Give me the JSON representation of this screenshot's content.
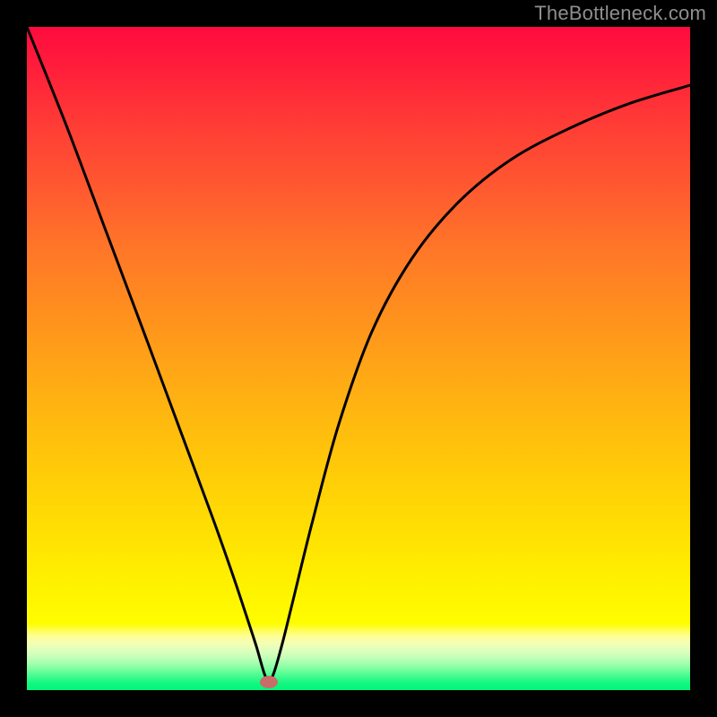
{
  "watermark": "TheBottleneck.com",
  "chart_data": {
    "type": "line",
    "title": "",
    "xlabel": "",
    "ylabel": "",
    "xlim": [
      0,
      1
    ],
    "ylim": [
      0,
      1
    ],
    "grid": false,
    "legend": false,
    "series": [
      {
        "name": "curve",
        "x": [
          0.0,
          0.06,
          0.12,
          0.18,
          0.23,
          0.28,
          0.31,
          0.33,
          0.346,
          0.36,
          0.37,
          0.384,
          0.4,
          0.43,
          0.47,
          0.52,
          0.58,
          0.65,
          0.73,
          0.82,
          0.91,
          1.0
        ],
        "y": [
          1.0,
          0.85,
          0.69,
          0.53,
          0.395,
          0.26,
          0.175,
          0.115,
          0.066,
          0.02,
          0.02,
          0.066,
          0.13,
          0.252,
          0.4,
          0.54,
          0.65,
          0.735,
          0.8,
          0.848,
          0.885,
          0.912
        ]
      }
    ],
    "marker": {
      "x": 0.365,
      "y": 0.012
    },
    "background": {
      "type": "vertical-gradient",
      "stops": [
        {
          "pos": 0.0,
          "color": "#ff0b3e"
        },
        {
          "pos": 0.5,
          "color": "#ff9c1b"
        },
        {
          "pos": 0.9,
          "color": "#fffd00"
        },
        {
          "pos": 1.0,
          "color": "#00f67c"
        }
      ]
    }
  }
}
